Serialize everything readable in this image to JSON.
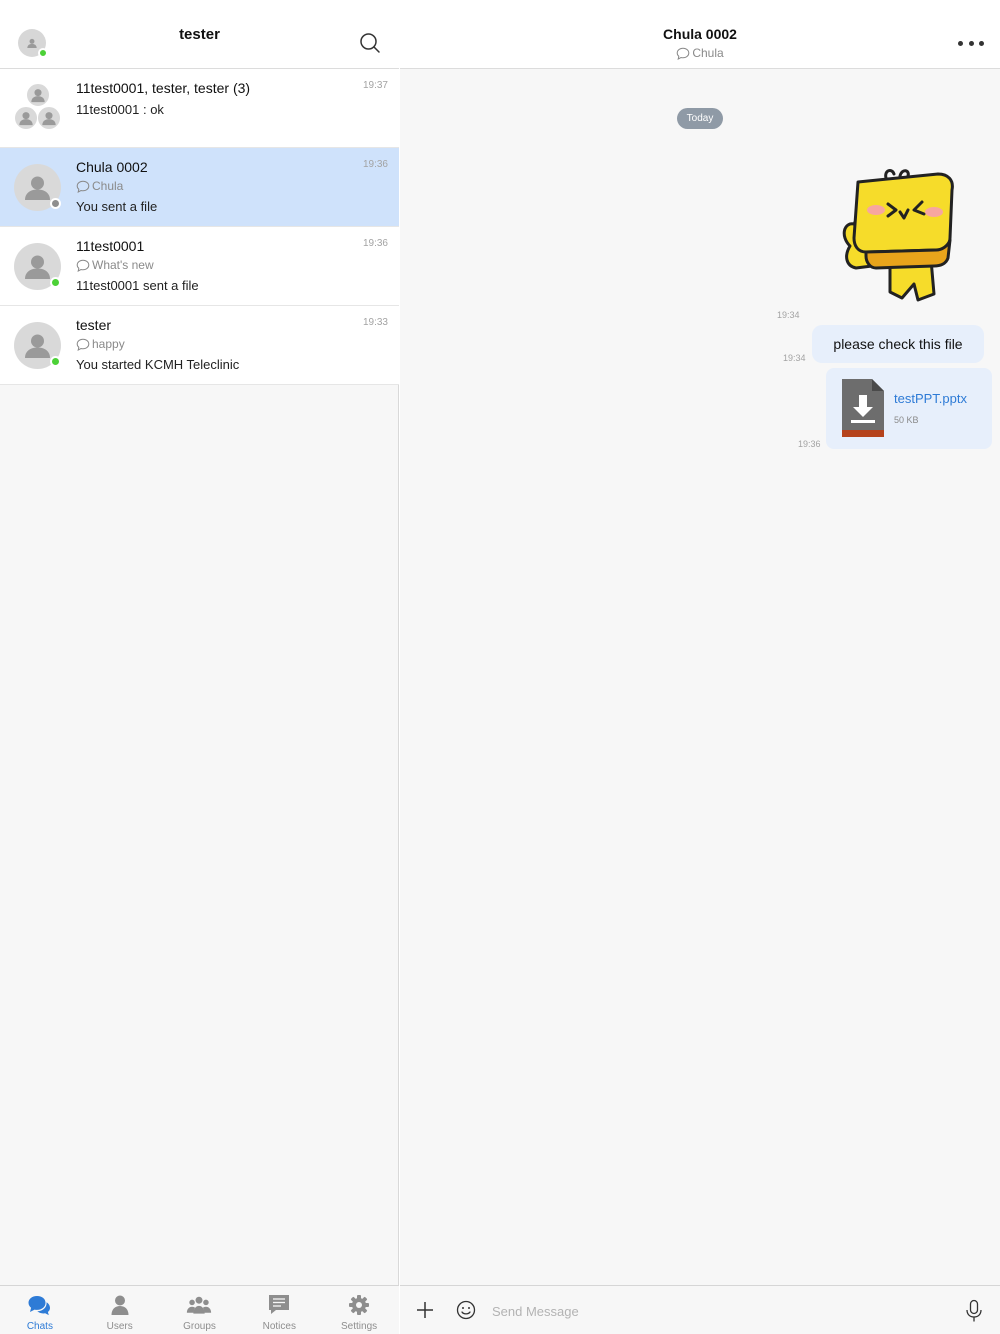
{
  "left_header": {
    "title": "tester"
  },
  "chats": [
    {
      "name": "11test0001, tester, tester (3)",
      "status": "",
      "preview": "11test0001 : ok",
      "time": "19:37",
      "kind": "group"
    },
    {
      "name": "Chula 0002",
      "status": "Chula",
      "preview": "You sent a file",
      "time": "19:36",
      "kind": "user",
      "presence": "offline",
      "selected": true
    },
    {
      "name": "11test0001",
      "status": "What's new",
      "preview": "11test0001 sent a file",
      "time": "19:36",
      "kind": "user",
      "presence": "online"
    },
    {
      "name": "tester",
      "status": "happy",
      "preview": "You started KCMH Teleclinic",
      "time": "19:33",
      "kind": "user",
      "presence": "online"
    }
  ],
  "tabs": [
    {
      "label": "Chats",
      "icon": "chats-icon",
      "active": true
    },
    {
      "label": "Users",
      "icon": "users-icon"
    },
    {
      "label": "Groups",
      "icon": "groups-icon"
    },
    {
      "label": "Notices",
      "icon": "notices-icon"
    },
    {
      "label": "Settings",
      "icon": "settings-icon"
    }
  ],
  "conversation": {
    "title": "Chula 0002",
    "status": "Chula",
    "date_divider": "Today",
    "messages": [
      {
        "type": "sticker",
        "time": "19:34",
        "sticker": "yellow-block-character-thumbs-up-wink"
      },
      {
        "type": "text",
        "text": "please check this file",
        "time": "19:34"
      },
      {
        "type": "file",
        "file_name": "testPPT.pptx",
        "file_size": "50 KB",
        "time": "19:36"
      }
    ]
  },
  "composer": {
    "placeholder": "Send Message"
  },
  "colors": {
    "accent": "#2e7bd6",
    "selected_row": "#cfe2fb",
    "bubble": "#e7effb",
    "online": "#4cd137",
    "date_pill": "#8f9aa6"
  }
}
